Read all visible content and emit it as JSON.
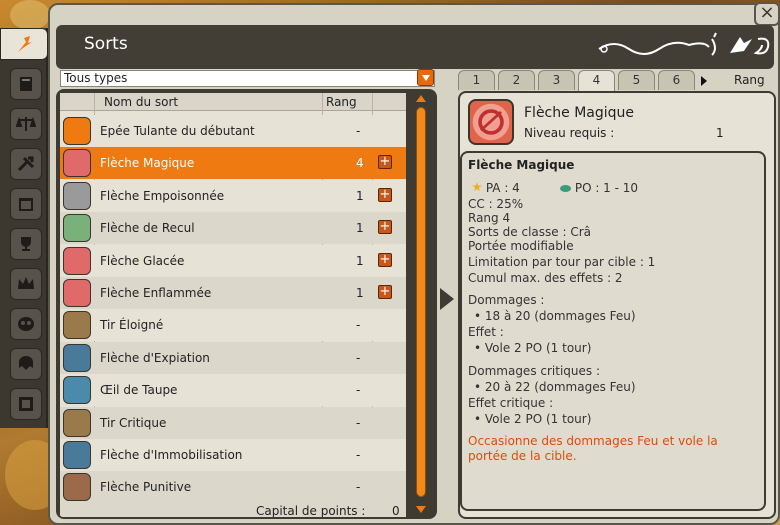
{
  "window": {
    "title": "Sorts",
    "close": "×"
  },
  "filter": {
    "selected": "Tous types"
  },
  "columns": {
    "name": "Nom du sort",
    "rank": "Rang"
  },
  "spells": [
    {
      "name": "Epée Tulante du débutant",
      "rank": "-",
      "upgradable": false,
      "color": "#f07a12"
    },
    {
      "name": "Flèche Magique",
      "rank": "4",
      "upgradable": true,
      "color": "#e06a6a",
      "selected": true
    },
    {
      "name": "Flèche Empoisonnée",
      "rank": "1",
      "upgradable": true,
      "color": "#9a9a9a"
    },
    {
      "name": "Flèche de Recul",
      "rank": "1",
      "upgradable": true,
      "color": "#7ab07a"
    },
    {
      "name": "Flèche Glacée",
      "rank": "1",
      "upgradable": true,
      "color": "#e06a6a"
    },
    {
      "name": "Flèche Enflammée",
      "rank": "1",
      "upgradable": true,
      "color": "#e06a6a"
    },
    {
      "name": "Tir Éloigné",
      "rank": "-",
      "upgradable": false,
      "color": "#9a7a4a"
    },
    {
      "name": "Flèche d'Expiation",
      "rank": "-",
      "upgradable": false,
      "color": "#4a7a9a"
    },
    {
      "name": "Œil de Taupe",
      "rank": "-",
      "upgradable": false,
      "color": "#4a8aaa"
    },
    {
      "name": "Tir Critique",
      "rank": "-",
      "upgradable": false,
      "color": "#9a7a4a"
    },
    {
      "name": "Flèche d'Immobilisation",
      "rank": "-",
      "upgradable": false,
      "color": "#4a7a9a"
    },
    {
      "name": "Flèche Punitive",
      "rank": "-",
      "upgradable": false,
      "color": "#9a6a4a"
    }
  ],
  "capital": {
    "label": "Capital de points :",
    "value": "0"
  },
  "tabs": [
    "1",
    "2",
    "3",
    "4",
    "5",
    "6"
  ],
  "active_tab": "4",
  "tab_rang": "Rang",
  "detail": {
    "name": "Flèche Magique",
    "level_label": "Niveau requis :",
    "level_value": "1",
    "heading": "Flèche Magique",
    "pa": "PA : 4",
    "po": "PO : 1 - 10",
    "cc": "CC : 25%",
    "rang": "Rang 4",
    "classe": "Sorts de classe : Crâ",
    "portee": "Portée modifiable",
    "limit1": "Limitation par tour par cible : 1",
    "limit2": "Cumul max. des effets : 2",
    "dmg_label": "Dommages :",
    "dmg_value": "• 18 à 20 (dommages Feu)",
    "effet_label": "Effet :",
    "effet_value": "• Vole 2 PO (1 tour)",
    "crit_label": "Dommages critiques :",
    "crit_value": "• 20 à 22 (dommages Feu)",
    "effetc_label": "Effet critique :",
    "effetc_value": "• Vole 2 PO (1 tour)",
    "desc1": "Occasionne des dommages Feu et vole la",
    "desc2": "portée de la cible."
  }
}
